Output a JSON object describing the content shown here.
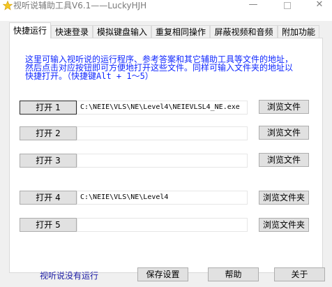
{
  "window": {
    "title": "视听说辅助工具V6.1——LuckyHJH",
    "minimize": "—",
    "close": "✕"
  },
  "tabs": [
    {
      "label": "快捷运行"
    },
    {
      "label": "快速登录"
    },
    {
      "label": "模拟键盘输入"
    },
    {
      "label": "重复相同操作"
    },
    {
      "label": "屏蔽视频和音频"
    },
    {
      "label": "附加功能"
    }
  ],
  "info": {
    "line1": "这里可输入视听说的运行程序、参考答案和其它辅助工具等文件的地址，",
    "line2": "然后点击对应按钮即可方便地打开这些文件。同样可输入文件夹的地址以",
    "line3": "快捷打开。（快捷键Alt + 1～5）"
  },
  "rows": [
    {
      "open": "打开 1",
      "path": "C:\\NEIE\\VLS\\NE\\Level4\\NEIEVLSL4_NE.exe",
      "browse": "浏览文件"
    },
    {
      "open": "打开 2",
      "path": "",
      "browse": "浏览文件"
    },
    {
      "open": "打开 3",
      "path": "",
      "browse": "浏览文件"
    },
    {
      "open": "打开 4",
      "path": "C:\\NEIE\\VLS\\NE\\Level4",
      "browse": "浏览文件夹"
    },
    {
      "open": "打开 5",
      "path": "",
      "browse": "浏览文件夹"
    }
  ],
  "footer": {
    "status": "视听说没有运行",
    "save": "保存设置",
    "help": "帮助",
    "about": "关于"
  },
  "colors": {
    "info_text": "#1028ff",
    "status_text": "#1a1aa6",
    "dialog_bg": "#f0f0f0",
    "button_bg": "#e1e1e1"
  }
}
